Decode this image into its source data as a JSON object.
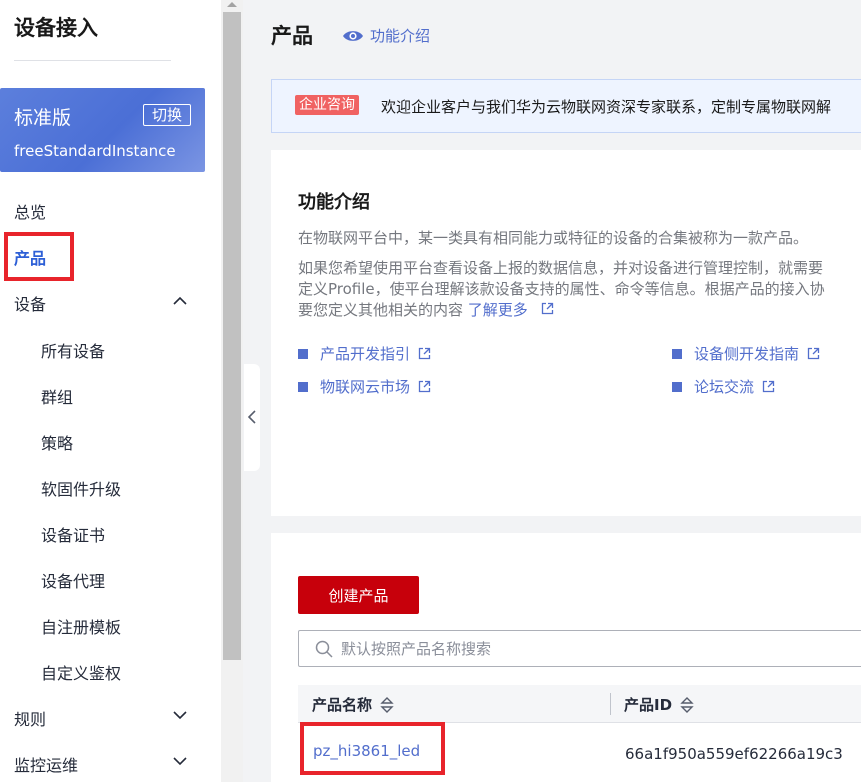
{
  "sidebar": {
    "title": "设备接入",
    "edition": {
      "name": "标准版",
      "switch_label": "切换",
      "instance": "freeStandardInstance"
    },
    "items": [
      {
        "label": "总览"
      },
      {
        "label": "产品",
        "active": true
      },
      {
        "label": "设备",
        "expanded": true
      },
      {
        "label": "规则",
        "expanded": false
      },
      {
        "label": "监控运维",
        "expanded": false
      }
    ],
    "device_subitems": [
      "所有设备",
      "群组",
      "策略",
      "软固件升级",
      "设备证书",
      "设备代理",
      "自注册模板",
      "自定义鉴权"
    ]
  },
  "header": {
    "title": "产品",
    "intro_link": "功能介绍"
  },
  "banner": {
    "tag": "企业咨询",
    "text": "欢迎企业客户与我们华为云物联网资深专家联系，定制专属物联网解"
  },
  "features": {
    "title": "功能介绍",
    "desc": "在物联网平台中，某一类具有相同能力或特征的设备的合集被称为一款产品。",
    "para_lines": [
      "如果您希望使用平台查看设备上报的数据信息，并对设备进行管理控制，就需要",
      "定义Profile，使平台理解该款设备支持的属性、命令等信息。根据产品的接入协",
      "要您定义其他相关的内容"
    ],
    "learn_more": "了解更多",
    "links": [
      "产品开发指引",
      "设备侧开发指南",
      "物联网云市场",
      "论坛交流"
    ]
  },
  "products": {
    "create_button": "创建产品",
    "search_placeholder": "默认按照产品名称搜索",
    "columns": [
      "产品名称",
      "产品ID"
    ],
    "rows": [
      {
        "name": "pz_hi3861_led",
        "id": "66a1f950a559ef62266a19c3"
      }
    ]
  },
  "colors": {
    "brand_red": "#c7000b",
    "link_blue": "#526ecc",
    "highlight_red": "#e8242b",
    "edition_blue": "#4b6fd6"
  }
}
